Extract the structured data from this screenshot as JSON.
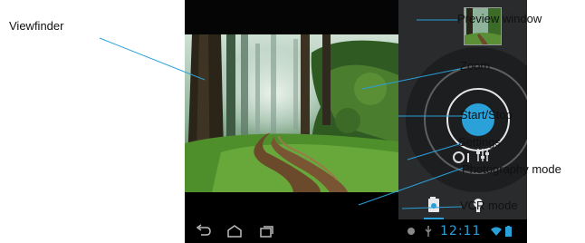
{
  "labels": {
    "viewfinder": "Viewfinder",
    "preview_window": "Preview window",
    "zoom": "Zoom",
    "start_stop": "Start/Stop",
    "settings": "Settings",
    "photography_mode": "Photography mode",
    "vcr_mode": "VCR mode"
  },
  "status_bar": {
    "clock": "12:11"
  },
  "icons": {
    "back": "back-arrow-icon",
    "home": "home-icon",
    "recent": "recent-apps-icon",
    "settings": "sliders-icon",
    "video": "video-camera-icon",
    "photo": "camera-icon",
    "usb": "usb-icon",
    "wifi": "wifi-icon",
    "battery": "battery-icon"
  },
  "colors": {
    "accent": "#29a0d7",
    "panel": "#2a2b2d",
    "callout_line": "#29a0d7"
  }
}
